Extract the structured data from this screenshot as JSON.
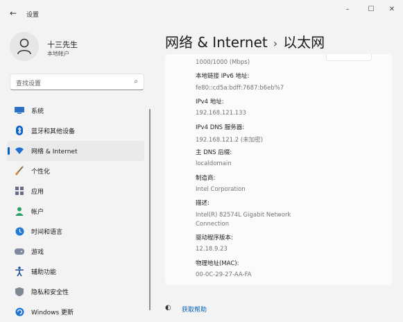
{
  "window": {
    "title": "设置",
    "back": "←",
    "minimize": "–",
    "maximize": "☐",
    "close": "✕"
  },
  "profile": {
    "name": "十三先生",
    "subtitle": "本地帐户"
  },
  "search": {
    "placeholder": "查找设置"
  },
  "nav": [
    {
      "label": "系统",
      "icon": "monitor-icon"
    },
    {
      "label": "蓝牙和其他设备",
      "icon": "bluetooth-icon"
    },
    {
      "label": "网络 & Internet",
      "icon": "wifi-icon",
      "active": true
    },
    {
      "label": "个性化",
      "icon": "brush-icon"
    },
    {
      "label": "应用",
      "icon": "apps-icon"
    },
    {
      "label": "帐户",
      "icon": "person-icon"
    },
    {
      "label": "时间和语言",
      "icon": "clock-globe-icon"
    },
    {
      "label": "游戏",
      "icon": "gamepad-icon"
    },
    {
      "label": "辅助功能",
      "icon": "accessibility-icon"
    },
    {
      "label": "隐私和安全性",
      "icon": "shield-icon"
    },
    {
      "label": "Windows 更新",
      "icon": "update-icon"
    }
  ],
  "breadcrumb": {
    "parent": "网络 & Internet",
    "separator": "›",
    "current": "以太网"
  },
  "properties": [
    {
      "label": "",
      "value": "1000/1000 (Mbps)"
    },
    {
      "label": "本地链接 IPv6 地址:",
      "value": "fe80::cd5a:bdff:7687:b6eb%7"
    },
    {
      "label": "IPv4 地址:",
      "value": "192.168.121.133"
    },
    {
      "label": "IPv4 DNS 服务器:",
      "value": "192.168.121.2 (未加密)"
    },
    {
      "label": "主 DNS 后缀:",
      "value": "localdomain"
    },
    {
      "label": "制造商:",
      "value": "Intel Corporation"
    },
    {
      "label": "描述:",
      "value": "Intel(R) 82574L Gigabit Network",
      "value2": "Connection"
    },
    {
      "label": "驱动程序版本:",
      "value": "12.18.9.23"
    },
    {
      "label": "物理地址(MAC):",
      "value": "00-0C-29-27-AA-FA"
    }
  ],
  "help": {
    "label": "获取帮助"
  },
  "colors": {
    "accent": "#0067c0",
    "link": "#005fb8",
    "background": "#f3f3f3",
    "panel": "#fbfbfb"
  }
}
